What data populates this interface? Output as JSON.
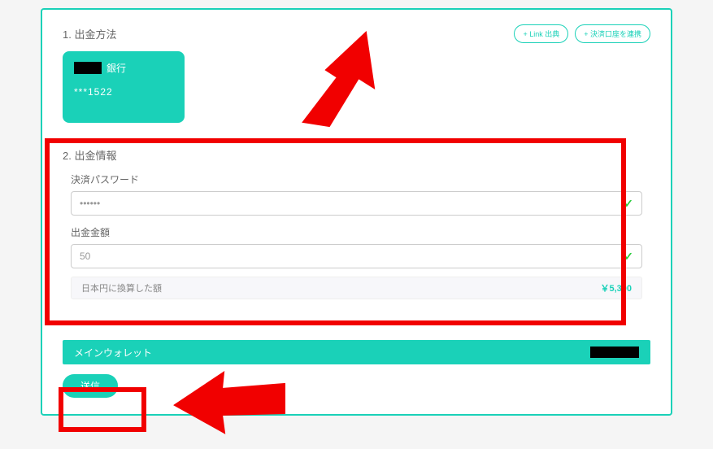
{
  "section1": {
    "title": "1. 出金方法",
    "buttons": {
      "small": "+ Link 出典",
      "connect": "+ 決済口座を連携"
    },
    "bank": {
      "name": "銀行",
      "number": "***1522"
    }
  },
  "section2": {
    "title": "2. 出金情報",
    "password": {
      "label": "決済パスワード",
      "value": "••••••"
    },
    "amount": {
      "label": "出金金額",
      "value": "50"
    },
    "conversion": {
      "label": "日本円に換算した額",
      "value": "￥5,300"
    }
  },
  "wallet": {
    "title": "メインウォレット"
  },
  "submit": {
    "label": "送信"
  }
}
